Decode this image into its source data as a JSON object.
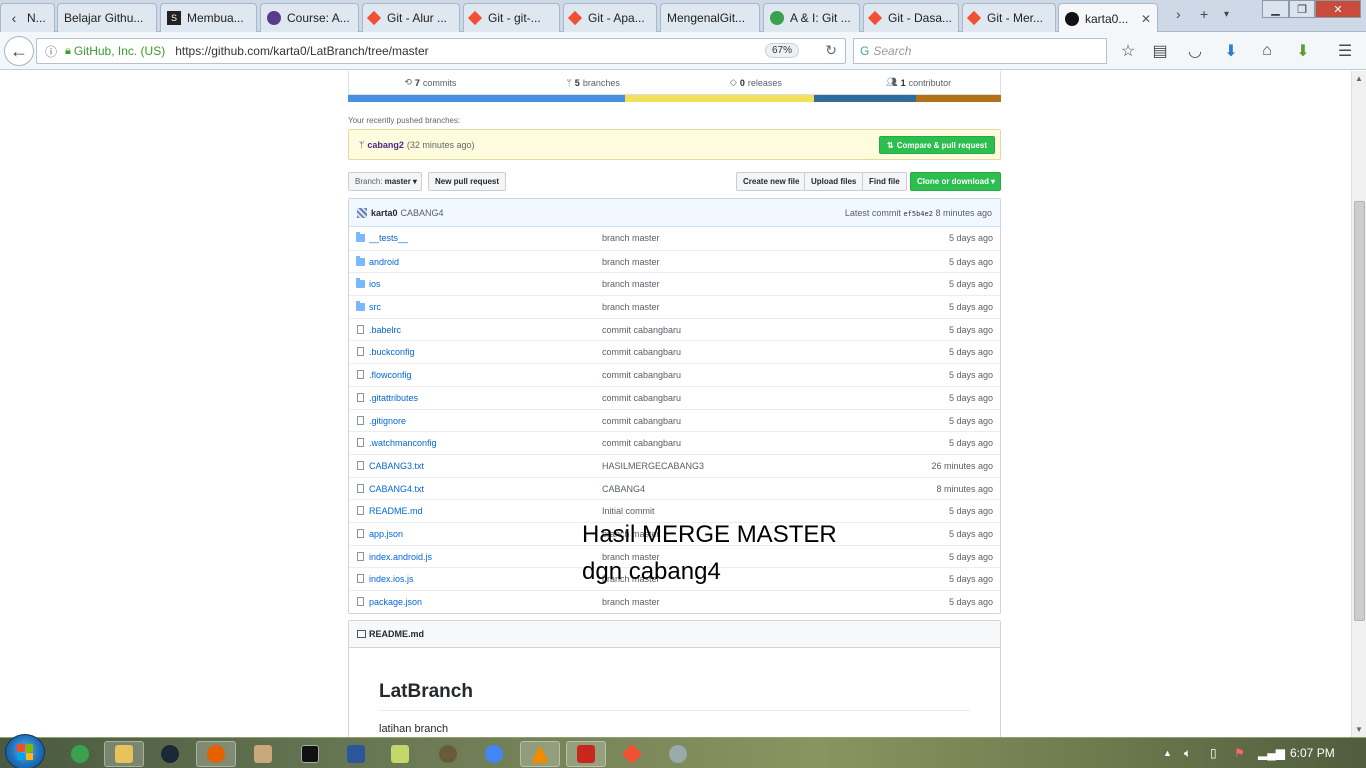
{
  "browser": {
    "tabs": [
      {
        "label": "N...",
        "icon": "chevron-left-icon"
      },
      {
        "label": "Belajar Githu...",
        "icon": "none"
      },
      {
        "label": "Membua...",
        "icon": "s-logo-icon"
      },
      {
        "label": "Course: A...",
        "icon": "course-logo-icon"
      },
      {
        "label": "Git - Alur ...",
        "icon": "git-icon"
      },
      {
        "label": "Git - git-...",
        "icon": "git-icon"
      },
      {
        "label": "Git - Apa...",
        "icon": "git-icon"
      },
      {
        "label": "MengenalGit...",
        "icon": "none"
      },
      {
        "label": "A & I: Git ...",
        "icon": "ai-logo-icon"
      },
      {
        "label": "Git - Dasa...",
        "icon": "git-icon"
      },
      {
        "label": "Git - Mer...",
        "icon": "git-icon"
      },
      {
        "label": "karta0...",
        "icon": "github-icon",
        "active": true
      }
    ],
    "url": {
      "org": "GitHub, Inc. (US)",
      "address": "https://github.com/karta0/LatBranch/tree/master",
      "zoom": "67%"
    },
    "search_placeholder": "Search"
  },
  "repo": {
    "summary": {
      "commits_count": "7",
      "commits_label": "commits",
      "branches_count": "5",
      "branches_label": "branches",
      "releases_count": "0",
      "releases_label": "releases",
      "contributors_count": "1",
      "contributors_label": "contributor"
    },
    "language_colors": [
      "#4a90e2",
      "#f1e05a",
      "#2f6c9e",
      "#b07219"
    ],
    "recent": {
      "label": "Your recently pushed branches:",
      "branch": "cabang2",
      "time": "(32 minutes ago)",
      "compare_button": "Compare & pull request"
    },
    "toolbar": {
      "branch_prefix": "Branch:",
      "branch_name": "master",
      "new_pr": "New pull request",
      "create_file": "Create new file",
      "upload_files": "Upload files",
      "find_file": "Find file",
      "clone": "Clone or download"
    },
    "latest_commit": {
      "author": "karta0",
      "message": "CABANG4",
      "prefix": "Latest commit",
      "sha": "ef5b4e2",
      "age": "8 minutes ago"
    },
    "files": [
      {
        "name": "__tests__",
        "type": "dir",
        "message": "branch master",
        "age": "5 days ago"
      },
      {
        "name": "android",
        "type": "dir",
        "message": "branch master",
        "age": "5 days ago"
      },
      {
        "name": "ios",
        "type": "dir",
        "message": "branch master",
        "age": "5 days ago"
      },
      {
        "name": "src",
        "type": "dir",
        "message": "branch master",
        "age": "5 days ago"
      },
      {
        "name": ".babelrc",
        "type": "file",
        "message": "commit cabangbaru",
        "age": "5 days ago"
      },
      {
        "name": ".buckconfig",
        "type": "file",
        "message": "commit cabangbaru",
        "age": "5 days ago"
      },
      {
        "name": ".flowconfig",
        "type": "file",
        "message": "commit cabangbaru",
        "age": "5 days ago"
      },
      {
        "name": ".gitattributes",
        "type": "file",
        "message": "commit cabangbaru",
        "age": "5 days ago"
      },
      {
        "name": ".gitignore",
        "type": "file",
        "message": "commit cabangbaru",
        "age": "5 days ago"
      },
      {
        "name": ".watchmanconfig",
        "type": "file",
        "message": "commit cabangbaru",
        "age": "5 days ago"
      },
      {
        "name": "CABANG3.txt",
        "type": "file",
        "message": "HASILMERGECABANG3",
        "age": "26 minutes ago"
      },
      {
        "name": "CABANG4.txt",
        "type": "file",
        "message": "CABANG4",
        "age": "8 minutes ago"
      },
      {
        "name": "README.md",
        "type": "file",
        "message": "Initial commit",
        "age": "5 days ago"
      },
      {
        "name": "app.json",
        "type": "file",
        "message": "branch master",
        "age": "5 days ago"
      },
      {
        "name": "index.android.js",
        "type": "file",
        "message": "branch master",
        "age": "5 days ago"
      },
      {
        "name": "index.ios.js",
        "type": "file",
        "message": "branch master",
        "age": "5 days ago"
      },
      {
        "name": "package.json",
        "type": "file",
        "message": "branch master",
        "age": "5 days ago"
      }
    ],
    "readme": {
      "filename": "README.md",
      "title": "LatBranch",
      "body": "latihan branch"
    }
  },
  "annotation": "Hasil MERGE MASTER\ndgn cabang4",
  "taskbar": {
    "time": "6:07 PM"
  }
}
